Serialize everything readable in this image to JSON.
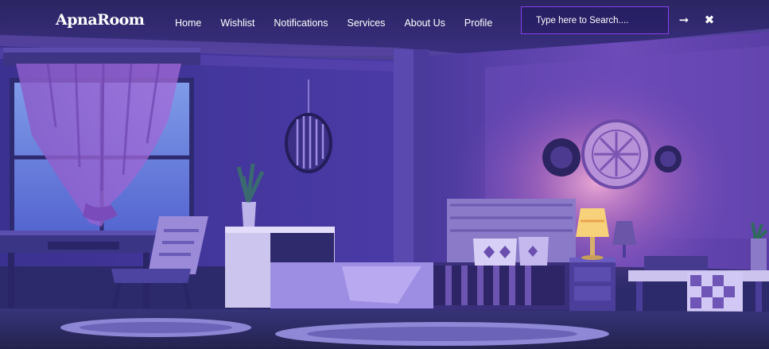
{
  "brand": {
    "name": "ApnaRoom"
  },
  "nav": {
    "items": [
      {
        "label": "Home"
      },
      {
        "label": "Wishlist"
      },
      {
        "label": "Notifications"
      },
      {
        "label": "Services"
      },
      {
        "label": "About Us"
      },
      {
        "label": "Profile"
      }
    ]
  },
  "search": {
    "placeholder": "Type here to Search....",
    "value": "",
    "submit_icon": "arrow-right-icon",
    "close_icon": "close-icon"
  },
  "hero": {
    "image": "purple-bedroom-night-illustration"
  },
  "colors": {
    "search_border": "#8b3fe8",
    "wall": "#4a3a9c",
    "floor": "#2d2d5e",
    "lamp_glow": "#f7c56a"
  }
}
